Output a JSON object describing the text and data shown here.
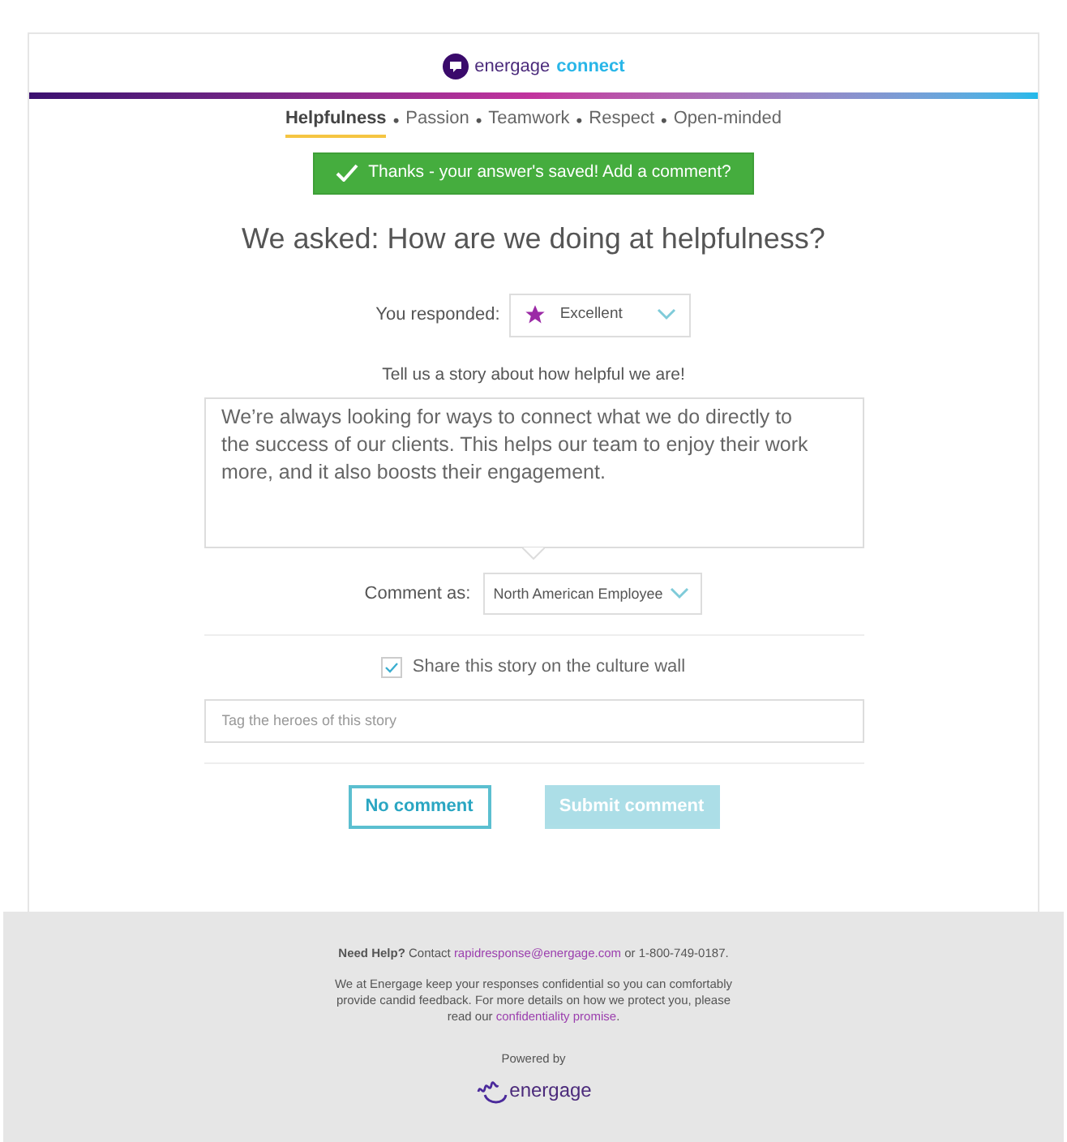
{
  "header": {
    "logo_primary": "energage",
    "logo_secondary": "connect"
  },
  "values_nav": {
    "separator": "•",
    "items": [
      {
        "label": "Helpfulness",
        "selected": true
      },
      {
        "label": "Passion",
        "selected": false
      },
      {
        "label": "Teamwork",
        "selected": false
      },
      {
        "label": "Respect",
        "selected": false
      },
      {
        "label": "Open-minded",
        "selected": false
      }
    ]
  },
  "banner": {
    "text": "Thanks - your answer's saved! Add a comment?"
  },
  "question": "We asked: How are we doing at helpfulness?",
  "response": {
    "label": "You responded:",
    "value": "Excellent"
  },
  "story": {
    "prompt": "Tell us a story about how helpful we are!",
    "value": "We’re always looking for ways to connect what we do directly to the success of our clients. This helps our team to enjoy their work more, and it also boosts their engagement."
  },
  "comment_as": {
    "label": "Comment as:",
    "value": "North American Employee"
  },
  "share": {
    "label": "Share this story on the culture wall",
    "checked": true
  },
  "tag_field": {
    "placeholder": "Tag the heroes of this story"
  },
  "buttons": [
    {
      "label": "No comment",
      "disabled": false,
      "kind": "outline"
    },
    {
      "label": "Submit comment",
      "disabled": true,
      "kind": "primary"
    }
  ],
  "footer": {
    "help_prefix": "**Need Help?** Contact ",
    "help_email": "rapidresponse@energage.com",
    "help_suffix": " or 1-800-749-0187.",
    "privacy_prefix": "We at Energage keep your responses confidential so you can comfortably provide candid feedback. For more details on how we protect you, please read our ",
    "privacy_link": "confidentiality promise",
    "privacy_suffix": ".",
    "powered_by": "Powered by",
    "brand": "energage"
  }
}
